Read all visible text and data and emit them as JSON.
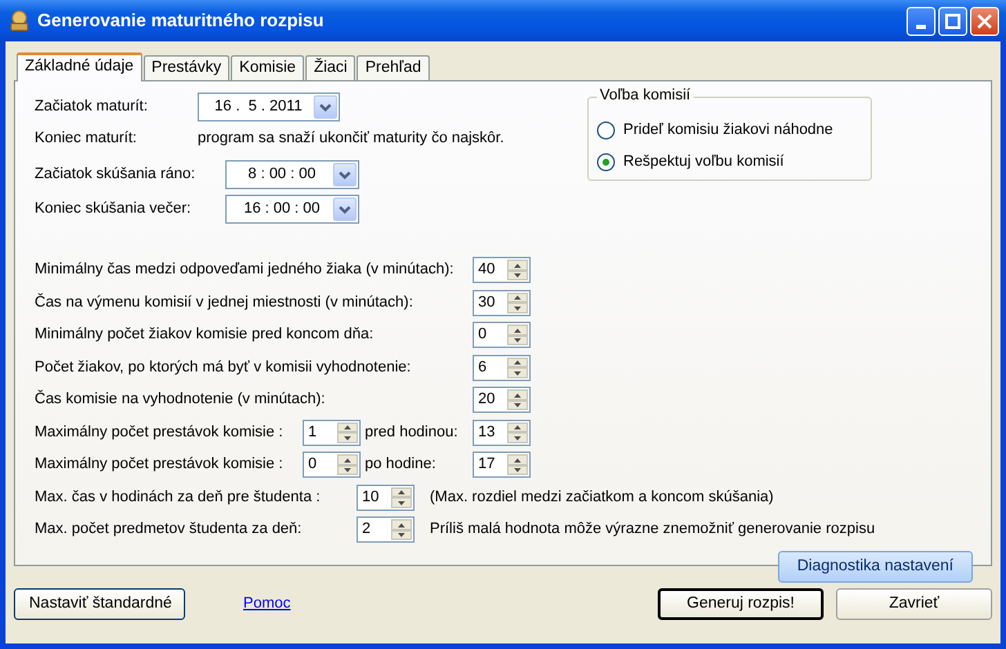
{
  "window": {
    "title": "Generovanie maturitného rozpisu"
  },
  "tabs": [
    {
      "label": "Základné údaje",
      "selected": true
    },
    {
      "label": "Prestávky",
      "selected": false
    },
    {
      "label": "Komisie",
      "selected": false
    },
    {
      "label": "Žiaci",
      "selected": false
    },
    {
      "label": "Prehľad",
      "selected": false
    }
  ],
  "top_rows": [
    {
      "kind": "picker",
      "label": "Začiatok maturít:",
      "value": "16 .  5 . 2011"
    },
    {
      "kind": "note",
      "label": "Koniec maturít:",
      "value": "program sa snaží ukončiť maturity čo najskôr."
    },
    {
      "kind": "picker",
      "label": "Začiatok skúšania ráno:",
      "value": "8 : 00 : 00"
    },
    {
      "kind": "picker",
      "label": "Koniec skúšania večer:",
      "value": "16 : 00 : 00"
    }
  ],
  "committee_choice": {
    "title": "Voľba komisií",
    "options": [
      {
        "label": "Prideľ komisiu žiakovi náhodne",
        "selected": false
      },
      {
        "label": "Rešpektuj voľbu komisií",
        "selected": true
      }
    ]
  },
  "settings": [
    {
      "kind": "single",
      "label": "Minimálny čas medzi odpoveďami jedného žiaka (v minútach):",
      "value": "40"
    },
    {
      "kind": "single",
      "label": "Čas na výmenu komisií v jednej miestnosti (v minútach):",
      "value": "30"
    },
    {
      "kind": "single",
      "label": "Minimálny počet žiakov komisie pred koncom dňa:",
      "value": "0"
    },
    {
      "kind": "single",
      "label": "Počet žiakov, po ktorých má byť v komisii vyhodnotenie:",
      "value": "6"
    },
    {
      "kind": "single",
      "label": "Čas komisie na vyhodnotenie (v minútach):",
      "value": "20"
    },
    {
      "kind": "pair",
      "label": "Maximálny počet prestávok komisie :",
      "value": "1",
      "label2": "pred hodinou:",
      "value2": "13"
    },
    {
      "kind": "pair",
      "label": "Maximálny počet prestávok komisie :",
      "value": "0",
      "label2": "po hodine:",
      "value2": "17"
    },
    {
      "kind": "hint",
      "label": "Max. čas v hodinách za deň pre študenta :",
      "value": "10",
      "hint": "(Max. rozdiel medzi začiatkom a koncom skúšania)"
    },
    {
      "kind": "hint",
      "label": "Max. počet predmetov študenta za deň:",
      "value": "2",
      "hint": "Príliš malá hodnota môže výrazne znemožniť generovanie rozpisu"
    }
  ],
  "diagnostics_button": "Diagnostika nastavení",
  "footer": {
    "defaults_button": "Nastaviť štandardné",
    "help_link": "Pomoc",
    "generate_button": "Generuj rozpis!",
    "close_button": "Zavrieť"
  }
}
